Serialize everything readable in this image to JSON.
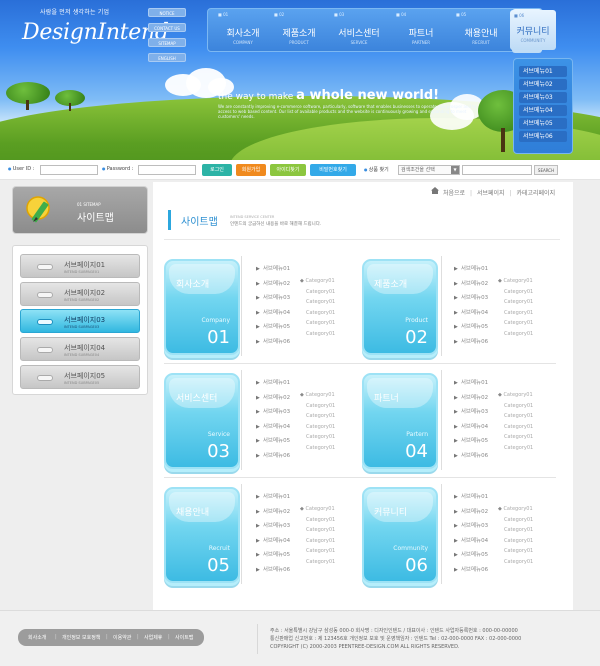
{
  "brand": {
    "tagline": "사람을 먼저 생각하는 기업",
    "logo_text": "DesignIntend"
  },
  "util_nav": [
    "NOTICE",
    "CONTACT US",
    "SITEMAP",
    "ENGLISH"
  ],
  "gnb": [
    {
      "num": "01",
      "ko": "회사소개",
      "en": "COMPANY"
    },
    {
      "num": "02",
      "ko": "제품소개",
      "en": "PRODUCT"
    },
    {
      "num": "03",
      "ko": "서비스센터",
      "en": "SERVICE"
    },
    {
      "num": "04",
      "ko": "파트너",
      "en": "PARTNER"
    },
    {
      "num": "05",
      "ko": "채용안내",
      "en": "RECRUIT"
    },
    {
      "num": "06",
      "ko": "커뮤니티",
      "en": "COMMUNITY"
    }
  ],
  "sub_menu": [
    "서브메뉴01",
    "서브메뉴02",
    "서브메뉴03",
    "서브메뉴04",
    "서브메뉴05",
    "서브메뉴06"
  ],
  "hero": {
    "slogan_prefix": "the ",
    "slogan_mid": "way to make ",
    "slogan_bold": "a whole new world!",
    "copy": "We are constantly improving e-commerce software, particularly, software that enables businesses to operate and prosper and to access to web based content. Our list of available products and the website is continuously growing and expanding to meet customers' needs."
  },
  "login": {
    "user_id_label": "User ID :",
    "password_label": "Password :",
    "login_btn": "로그인",
    "join_btn": "회원가입",
    "find_id_btn": "아이디찾기",
    "find_pw_btn": "비밀번호찾기",
    "search_label": "상품 찾기",
    "search_select": "검색조건을 선택",
    "search_btn": "SEARCH"
  },
  "lnb": {
    "num": "01 SITEMAP",
    "title": "사이트맵",
    "items": [
      {
        "ko": "서브페이지01",
        "en": "INTEND SUBPAGE01"
      },
      {
        "ko": "서브페이지02",
        "en": "INTEND SUBPAGE02"
      },
      {
        "ko": "서브페이지03",
        "en": "INTEND SUBPAGE03"
      },
      {
        "ko": "서브페이지04",
        "en": "INTEND SUBPAGE04"
      },
      {
        "ko": "서브페이지05",
        "en": "INTEND SUBPAGE05"
      }
    ]
  },
  "breadcrumb": {
    "home": "처음으로",
    "sep": "|",
    "sub": "서브페이지",
    "cat": "카테고리페이지"
  },
  "page": {
    "title": "사이트맵",
    "sub_en": "INTEND SERVICE CENTER",
    "sub_ko": "인텐드의 궁금하신 내용을 바로 해결해 드립니다."
  },
  "cards": [
    {
      "ko": "회사소개",
      "en": "Company",
      "num": "01"
    },
    {
      "ko": "제품소개",
      "en": "Product",
      "num": "02"
    },
    {
      "ko": "서비스센터",
      "en": "Service",
      "num": "03"
    },
    {
      "ko": "파트너",
      "en": "Partern",
      "num": "04"
    },
    {
      "ko": "채용안내",
      "en": "Recruit",
      "num": "05"
    },
    {
      "ko": "커뮤니티",
      "en": "Community",
      "num": "06"
    }
  ],
  "menu_items": [
    "서브메뉴01",
    "서브메뉴02",
    "서브메뉴03",
    "서브메뉴04",
    "서브메뉴05",
    "서브메뉴06"
  ],
  "category_items": [
    "Category01",
    "Category01",
    "Category01",
    "Category01",
    "Category01",
    "Category01"
  ],
  "footer": {
    "links": [
      "회사소개",
      "개인정보 보호정책",
      "이용약관",
      "사업제휴",
      "사이트맵"
    ],
    "sep": "|",
    "info": [
      "주소 : 서울특별시 강남구 삼성동 000-0 회사명 : 디자인인텐드 / 대표이사 : 인텐드 사업자등록번호 : 000-00-00000",
      "통신판매업 신고번호 : 제 123456호 개인정보 보호 및 운영책임자 : 인텐드   Tel : 02-000-0000  FAX : 02-000-0000",
      "COPYRIGHT (C) 2000-2003 PEENTREE-DESIGN.COM  ALL RIGHTS RESERVED."
    ]
  },
  "colors": {
    "accent_blue": "#2c8fd1",
    "card_cyan": "#3dbbe3",
    "login_btn": "#2cb3a6",
    "join_btn": "#f08a1e",
    "find_id_btn": "#8cc63f",
    "find_pw_btn": "#33a9e8"
  }
}
